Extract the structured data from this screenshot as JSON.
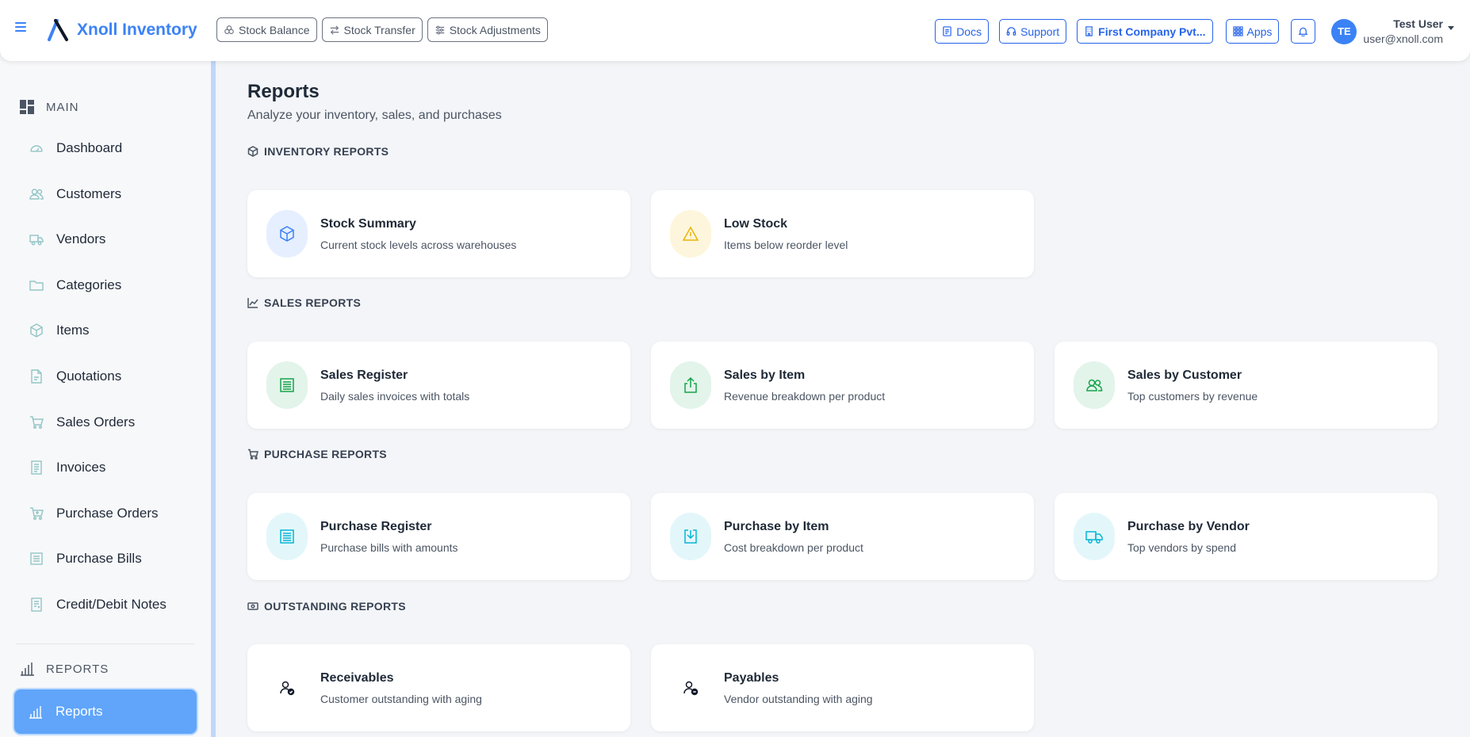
{
  "app": {
    "name": "Xnoll Inventory"
  },
  "quick_actions": [
    {
      "label": "Stock Balance",
      "icon": "boxes-icon"
    },
    {
      "label": "Stock Transfer",
      "icon": "transfer-arrows-icon"
    },
    {
      "label": "Stock Adjustments",
      "icon": "sliders-icon"
    }
  ],
  "header": {
    "docs": "Docs",
    "support": "Support",
    "company": "First Company Pvt...",
    "apps": "Apps",
    "user_initials": "TE",
    "user_name": "Test User",
    "user_email": "user@xnoll.com"
  },
  "sidebar": {
    "main_section": "MAIN",
    "items": [
      {
        "label": "Dashboard",
        "icon": "gauge-icon"
      },
      {
        "label": "Customers",
        "icon": "users-icon"
      },
      {
        "label": "Vendors",
        "icon": "truck-icon"
      },
      {
        "label": "Categories",
        "icon": "folder-icon"
      },
      {
        "label": "Items",
        "icon": "box-icon"
      },
      {
        "label": "Quotations",
        "icon": "document-icon"
      },
      {
        "label": "Sales Orders",
        "icon": "cart-icon"
      },
      {
        "label": "Invoices",
        "icon": "invoice-icon"
      },
      {
        "label": "Purchase Orders",
        "icon": "cart-plus-icon"
      },
      {
        "label": "Purchase Bills",
        "icon": "receipt-icon"
      },
      {
        "label": "Credit/Debit Notes",
        "icon": "notes-icon"
      }
    ],
    "reports_section": "REPORTS",
    "active_item": "Reports"
  },
  "page": {
    "title": "Reports",
    "subtitle": "Analyze your inventory, sales, and purchases"
  },
  "sections": {
    "inventory": {
      "heading": "INVENTORY REPORTS",
      "cards": [
        {
          "title": "Stock Summary",
          "desc": "Current stock levels across warehouses"
        },
        {
          "title": "Low Stock",
          "desc": "Items below reorder level"
        }
      ]
    },
    "sales": {
      "heading": "SALES REPORTS",
      "cards": [
        {
          "title": "Sales Register",
          "desc": "Daily sales invoices with totals"
        },
        {
          "title": "Sales by Item",
          "desc": "Revenue breakdown per product"
        },
        {
          "title": "Sales by Customer",
          "desc": "Top customers by revenue"
        }
      ]
    },
    "purchase": {
      "heading": "PURCHASE REPORTS",
      "cards": [
        {
          "title": "Purchase Register",
          "desc": "Purchase bills with amounts"
        },
        {
          "title": "Purchase by Item",
          "desc": "Cost breakdown per product"
        },
        {
          "title": "Purchase by Vendor",
          "desc": "Top vendors by spend"
        }
      ]
    },
    "outstanding": {
      "heading": "OUTSTANDING REPORTS",
      "cards": [
        {
          "title": "Receivables",
          "desc": "Customer outstanding with aging"
        },
        {
          "title": "Payables",
          "desc": "Vendor outstanding with aging"
        }
      ]
    }
  },
  "colors": {
    "accent": "#3b82f6",
    "active_bg": "#60a5fa",
    "page_bg": "#f3f5f8"
  }
}
